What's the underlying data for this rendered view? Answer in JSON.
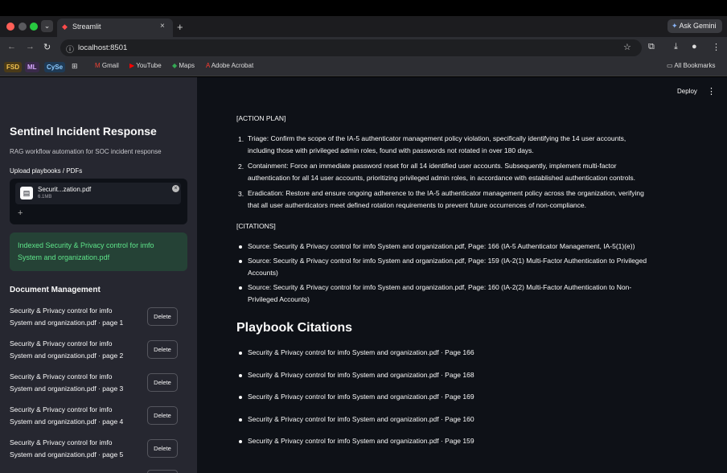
{
  "browser": {
    "tab_title": "Streamlit",
    "new_tab": "+",
    "tab_close": "×",
    "ask_gemini": "Ask Gemini",
    "url": "localhost:8501",
    "bookmarks": [
      {
        "label": "FSD",
        "icon": "fsd-chip"
      },
      {
        "label": "ML",
        "icon": "ml-chip"
      },
      {
        "label": "CySe",
        "icon": "cyse-chip"
      },
      {
        "label": "Gmail",
        "icon": "gmail-icon"
      },
      {
        "label": "YouTube",
        "icon": "youtube-icon"
      },
      {
        "label": "Maps",
        "icon": "maps-icon"
      },
      {
        "label": "Adobe Acrobat",
        "icon": "acrobat-icon"
      }
    ],
    "all_bookmarks": "All Bookmarks"
  },
  "sidebar": {
    "title": "Sentinel Incident Response",
    "subtitle": "RAG workflow automation for SOC incident response",
    "upload_label": "Upload playbooks / PDFs",
    "file": {
      "name": "Securit...zation.pdf",
      "size": "6.1MB"
    },
    "success_message": "Indexed Security & Privacy control for imfo System and organization.pdf",
    "doc_heading": "Document Management",
    "delete_label": "Delete",
    "documents": [
      {
        "line1": "Security & Privacy control for imfo",
        "line2": "System and organization.pdf · page 1"
      },
      {
        "line1": "Security & Privacy control for imfo",
        "line2": "System and organization.pdf · page 2"
      },
      {
        "line1": "Security & Privacy control for imfo",
        "line2": "System and organization.pdf · page 3"
      },
      {
        "line1": "Security & Privacy control for imfo",
        "line2": "System and organization.pdf · page 4"
      },
      {
        "line1": "Security & Privacy control for imfo",
        "line2": "System and organization.pdf · page 5"
      }
    ]
  },
  "header": {
    "deploy": "Deploy"
  },
  "main": {
    "action_plan_heading": "[ACTION PLAN]",
    "action_plan": [
      {
        "num": "1.",
        "line1": "Triage: Confirm the scope of the IA-5 authenticator management policy violation, specifically identifying the 14 user accounts,",
        "line2": "including those with privileged admin roles, found with passwords not rotated in over 180 days."
      },
      {
        "num": "2.",
        "line1": "Containment: Force an immediate password reset for all 14 identified user accounts. Subsequently, implement multi-factor",
        "line2": "authentication for all 14 user accounts, prioritizing privileged admin roles, in accordance with established authentication controls."
      },
      {
        "num": "3.",
        "line1": "Eradication: Restore and ensure ongoing adherence to the IA-5 authenticator management policy across the organization, verifying",
        "line2": "that all user authenticators meet defined rotation requirements to prevent future occurrences of non-compliance."
      }
    ],
    "citations_heading": "[CITATIONS]",
    "citations": [
      {
        "line1": "Source: Security & Privacy control for imfo System and organization.pdf, Page: 166 (IA-5 Authenticator Management, IA-5(1)(e))",
        "line2": ""
      },
      {
        "line1": "Source: Security & Privacy control for imfo System and organization.pdf, Page: 159 (IA-2(1) Multi-Factor Authentication to Privileged",
        "line2": "Accounts)"
      },
      {
        "line1": "Source: Security & Privacy control for imfo System and organization.pdf, Page: 160 (IA-2(2) Multi-Factor Authentication to Non-",
        "line2": "Privileged Accounts)"
      }
    ],
    "playbook_title": "Playbook Citations",
    "playbook_citations": [
      "Security & Privacy control for imfo System and organization.pdf · Page 166",
      "Security & Privacy control for imfo System and organization.pdf · Page 168",
      "Security & Privacy control for imfo System and organization.pdf · Page 169",
      "Security & Privacy control for imfo System and organization.pdf · Page 160",
      "Security & Privacy control for imfo System and organization.pdf · Page 159"
    ]
  },
  "colors": {
    "sidebar_bg": "#262730",
    "main_bg": "#0e1117",
    "success_text": "#5ee58a",
    "accent": "#ff4b4b"
  }
}
